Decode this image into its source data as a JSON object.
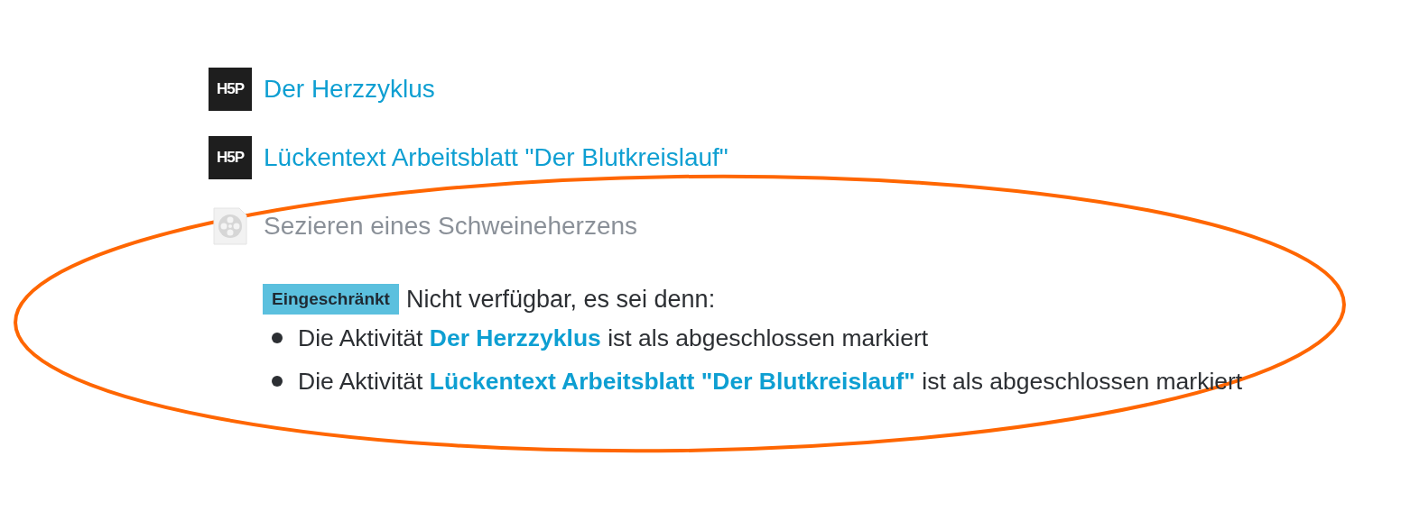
{
  "activities": [
    {
      "kind": "h5p",
      "icon_text": "H5P",
      "title": "Der Herzzyklus",
      "disabled": false
    },
    {
      "kind": "h5p",
      "icon_text": "H5P",
      "title": "Lückentext Arbeitsblatt \"Der Blutkreislauf\"",
      "disabled": false
    },
    {
      "kind": "video",
      "title": "Sezieren eines Schweineherzens",
      "disabled": true,
      "restriction": {
        "badge": "Eingeschränkt",
        "text": "Nicht verfügbar, es sei denn:",
        "conditions": [
          {
            "prefix": "Die Aktivität",
            "link": "Der Herzzyklus",
            "suffix": "ist als abgeschlossen markiert"
          },
          {
            "prefix": "Die Aktivität",
            "link": "Lückentext Arbeitsblatt \"Der Blutkreislauf\"",
            "suffix": "ist als abgeschlossen markiert"
          }
        ]
      }
    }
  ],
  "annotation": {
    "kind": "ellipse",
    "color": "#ff6600"
  }
}
